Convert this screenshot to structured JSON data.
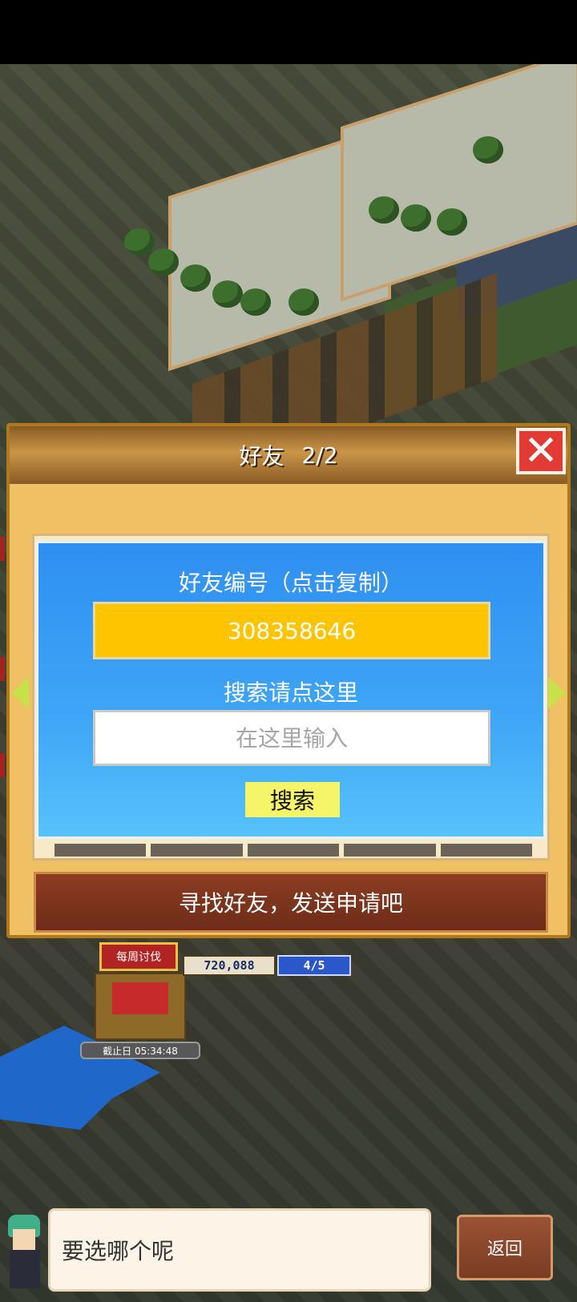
{
  "dialog": {
    "title": "好友",
    "count": "2/2",
    "close_icon": "close-icon",
    "panel_title": "好友编号（点击复制）",
    "friend_id": "308358646",
    "search_label": "搜索请点这里",
    "search_placeholder": "在这里输入",
    "search_button": "搜索",
    "action_label": "寻找好友，发送申请吧"
  },
  "weekly": {
    "badge": "每周讨伐",
    "score": "720,088",
    "ratio": "4/5",
    "deadline": "截止日 05:34:48"
  },
  "bottom": {
    "speech": "要选哪个呢",
    "back_button": "返回"
  },
  "colors": {
    "id_box": "#ffc400",
    "search_button": "#f6f56a",
    "close_button": "#e23b35"
  }
}
